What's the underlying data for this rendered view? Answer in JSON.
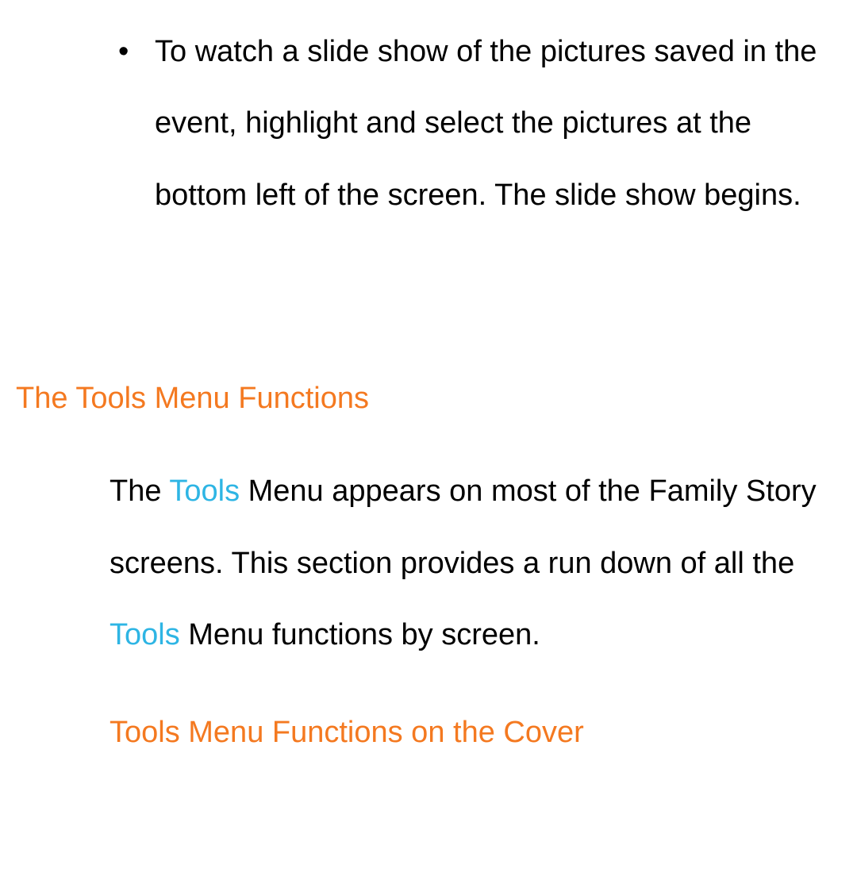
{
  "bullet": {
    "text": "To watch a slide show of the pictures saved in the event, highlight and select the pictures at the bottom left of the screen. The slide show begins."
  },
  "section": {
    "heading": "The Tools Menu Functions",
    "para_part1": "The ",
    "para_tools1": "Tools",
    "para_part2": " Menu appears on most of the Family Story screens. This section provides a run down of all the ",
    "para_tools2": "Tools",
    "para_part3": " Menu functions by screen."
  },
  "subsection": {
    "heading": "Tools Menu Functions on the Cover"
  }
}
